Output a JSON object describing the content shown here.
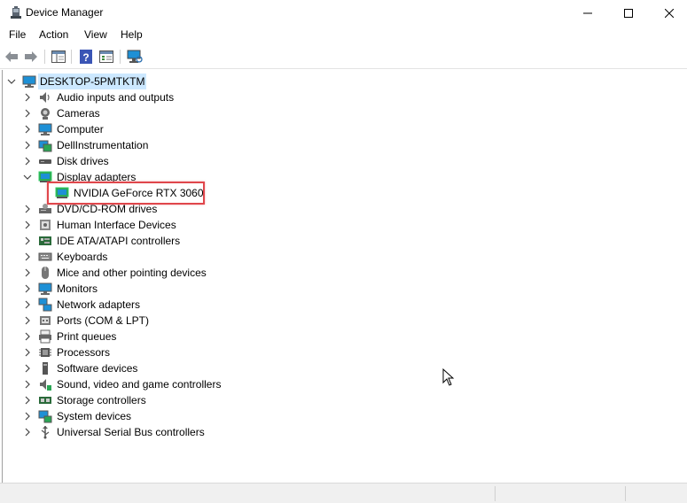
{
  "window": {
    "title": "Device Manager",
    "controls": {
      "minimize": "minimize-icon",
      "maximize": "maximize-icon",
      "close": "close-icon"
    }
  },
  "menu": [
    "File",
    "Action",
    "View",
    "Help"
  ],
  "toolbar": {
    "buttons": [
      "back-icon",
      "forward-icon",
      "show-hide-tree-icon",
      "help-icon",
      "properties-icon",
      "scan-hardware-icon"
    ]
  },
  "tree": {
    "root": "DESKTOP-5PMTKTM",
    "categories": [
      {
        "label": "Audio inputs and outputs",
        "icon": "speaker-icon",
        "expanded": false
      },
      {
        "label": "Cameras",
        "icon": "camera-icon",
        "expanded": false
      },
      {
        "label": "Computer",
        "icon": "computer-icon",
        "expanded": false
      },
      {
        "label": "DellInstrumentation",
        "icon": "device-icon",
        "expanded": false
      },
      {
        "label": "Disk drives",
        "icon": "disk-drive-icon",
        "expanded": false
      },
      {
        "label": "Display adapters",
        "icon": "display-adapter-icon",
        "expanded": true,
        "children": [
          {
            "label": "NVIDIA GeForce RTX 3060",
            "icon": "display-adapter-icon"
          }
        ]
      },
      {
        "label": "DVD/CD-ROM drives",
        "icon": "dvd-drive-icon",
        "expanded": false
      },
      {
        "label": "Human Interface Devices",
        "icon": "hid-icon",
        "expanded": false
      },
      {
        "label": "IDE ATA/ATAPI controllers",
        "icon": "ide-controller-icon",
        "expanded": false
      },
      {
        "label": "Keyboards",
        "icon": "keyboard-icon",
        "expanded": false
      },
      {
        "label": "Mice and other pointing devices",
        "icon": "mouse-icon",
        "expanded": false
      },
      {
        "label": "Monitors",
        "icon": "monitor-icon",
        "expanded": false
      },
      {
        "label": "Network adapters",
        "icon": "network-adapter-icon",
        "expanded": false
      },
      {
        "label": "Ports (COM & LPT)",
        "icon": "port-icon",
        "expanded": false
      },
      {
        "label": "Print queues",
        "icon": "printer-icon",
        "expanded": false
      },
      {
        "label": "Processors",
        "icon": "processor-icon",
        "expanded": false
      },
      {
        "label": "Software devices",
        "icon": "software-device-icon",
        "expanded": false
      },
      {
        "label": "Sound, video and game controllers",
        "icon": "sound-icon",
        "expanded": false
      },
      {
        "label": "Storage controllers",
        "icon": "storage-controller-icon",
        "expanded": false
      },
      {
        "label": "System devices",
        "icon": "system-device-icon",
        "expanded": false
      },
      {
        "label": "Universal Serial Bus controllers",
        "icon": "usb-icon",
        "expanded": false
      }
    ]
  },
  "colors": {
    "selection": "#cce8ff",
    "highlight_box": "#e0474c",
    "monitor_blue": "#1e90d6"
  }
}
